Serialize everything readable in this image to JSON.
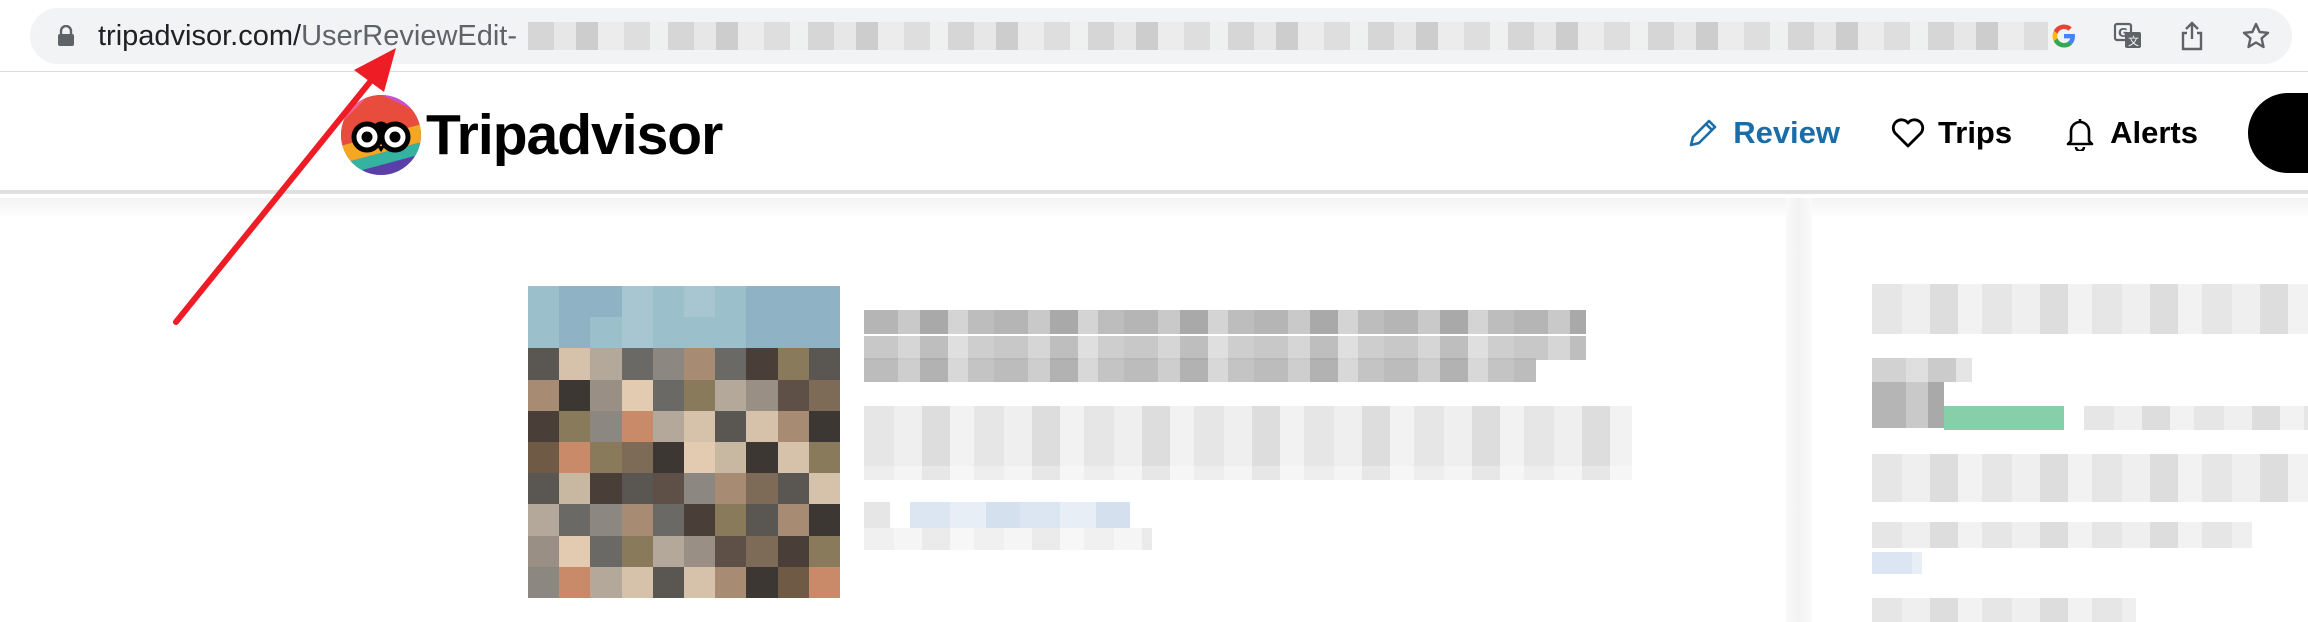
{
  "browser": {
    "url_domain": "tripadvisor.com/",
    "url_path": "UserReviewEdit-",
    "url_rest_redacted": true,
    "icons": [
      "lock-icon",
      "google-icon",
      "translate-icon",
      "share-icon",
      "bookmark-star-icon"
    ]
  },
  "header": {
    "logo_text": "Tripadvisor",
    "nav": {
      "review_label": "Review",
      "trips_label": "Trips",
      "alerts_label": "Alerts"
    },
    "icons": {
      "review": "pencil-icon",
      "trips": "heart-icon",
      "alerts": "bell-icon"
    }
  },
  "colors": {
    "review_accent": "#1a6ea8",
    "annotation_arrow": "#ee1c25"
  }
}
